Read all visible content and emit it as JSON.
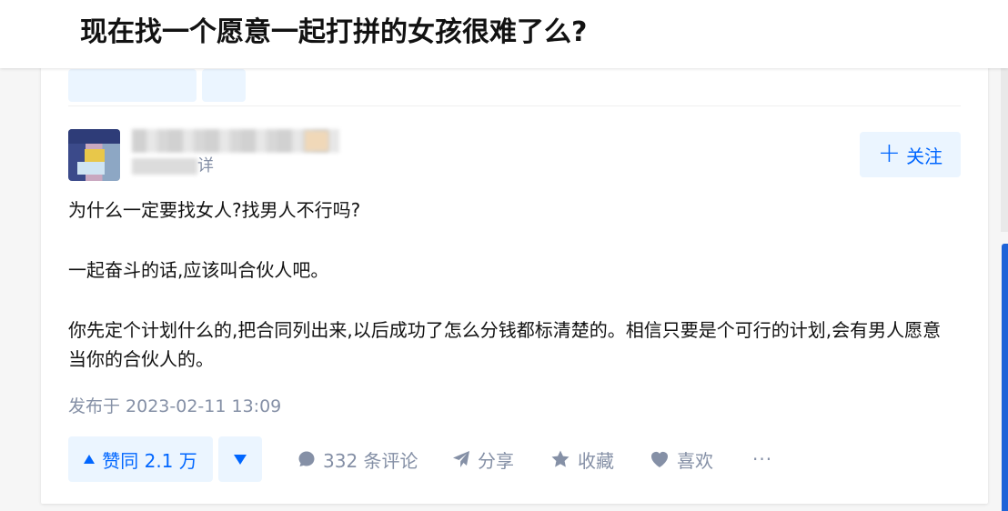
{
  "header": {
    "question_title": "现在找一个愿意一起打拼的女孩很难了么?"
  },
  "answer": {
    "author_bio_suffix": "详",
    "follow_label": "关注",
    "content": [
      "为什么一定要找女人?找男人不行吗?",
      "一起奋斗的话,应该叫合伙人吧。",
      "你先定个计划什么的,把合同列出来,以后成功了怎么分钱都标清楚的。相信只要是个可行的计划,会有男人愿意当你的合伙人的。"
    ],
    "publish_time": "发布于 2023-02-11 13:09"
  },
  "actions": {
    "upvote_label": "赞同 2.1 万",
    "comments_label": "332 条评论",
    "share_label": "分享",
    "collect_label": "收藏",
    "like_label": "喜欢",
    "more_label": "···"
  },
  "colors": {
    "accent": "#0066ff",
    "accent_bg": "#ebf5ff",
    "muted": "#8590a6",
    "text": "#121212"
  },
  "icons": [
    "plus-icon",
    "upvote-triangle-icon",
    "downvote-triangle-icon",
    "comment-icon",
    "share-icon",
    "star-icon",
    "heart-icon",
    "more-icon"
  ]
}
